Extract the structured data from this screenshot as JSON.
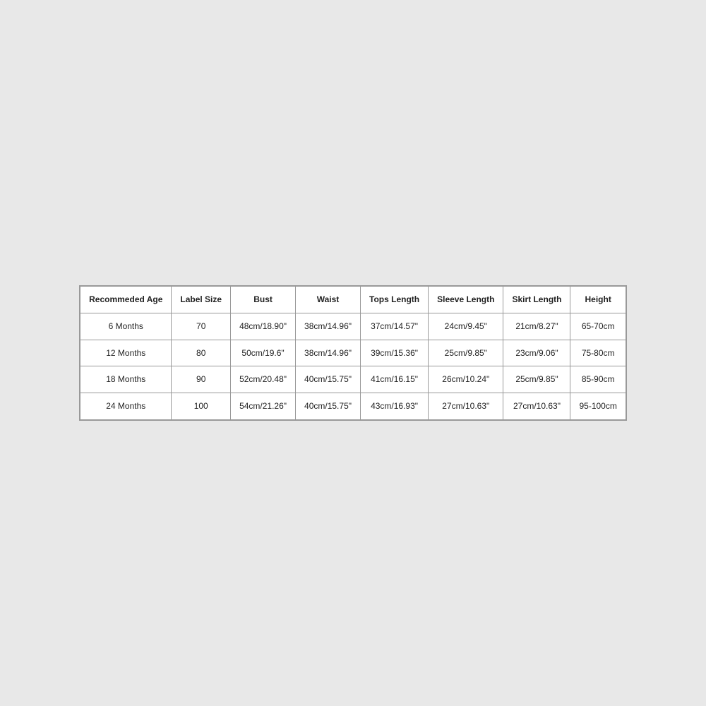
{
  "table": {
    "headers": [
      "Recommeded Age",
      "Label Size",
      "Bust",
      "Waist",
      "Tops Length",
      "Sleeve Length",
      "Skirt Length",
      "Height"
    ],
    "rows": [
      {
        "age": "6 Months",
        "label_size": "70",
        "bust": "48cm/18.90\"",
        "waist": "38cm/14.96\"",
        "tops_length": "37cm/14.57\"",
        "sleeve_length": "24cm/9.45\"",
        "skirt_length": "21cm/8.27\"",
        "height": "65-70cm"
      },
      {
        "age": "12 Months",
        "label_size": "80",
        "bust": "50cm/19.6\"",
        "waist": "38cm/14.96\"",
        "tops_length": "39cm/15.36\"",
        "sleeve_length": "25cm/9.85\"",
        "skirt_length": "23cm/9.06\"",
        "height": "75-80cm"
      },
      {
        "age": "18 Months",
        "label_size": "90",
        "bust": "52cm/20.48\"",
        "waist": "40cm/15.75\"",
        "tops_length": "41cm/16.15\"",
        "sleeve_length": "26cm/10.24\"",
        "skirt_length": "25cm/9.85\"",
        "height": "85-90cm"
      },
      {
        "age": "24 Months",
        "label_size": "100",
        "bust": "54cm/21.26\"",
        "waist": "40cm/15.75\"",
        "tops_length": "43cm/16.93\"",
        "sleeve_length": "27cm/10.63\"",
        "skirt_length": "27cm/10.63\"",
        "height": "95-100cm"
      }
    ]
  }
}
